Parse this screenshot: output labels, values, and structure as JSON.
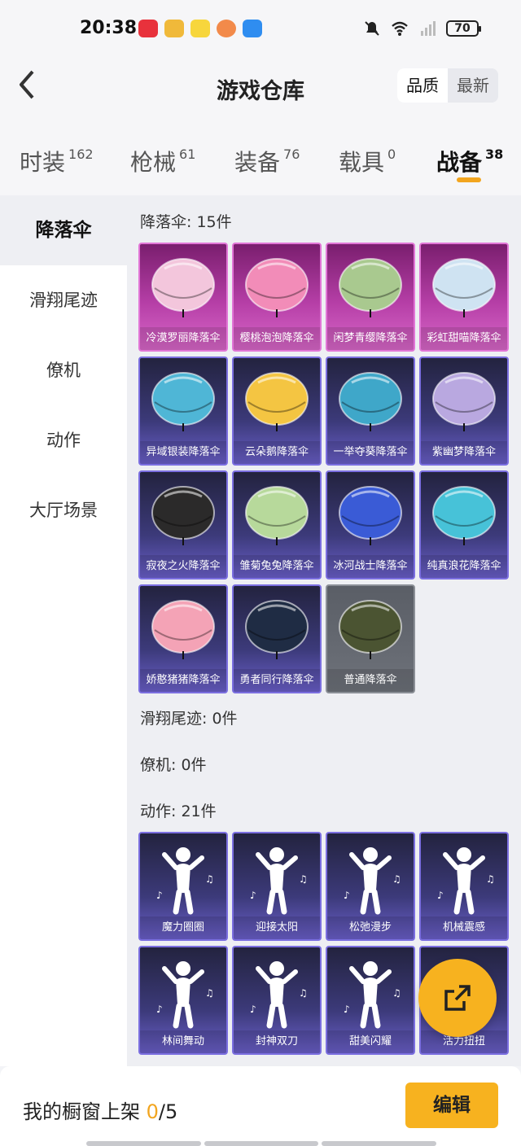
{
  "status_bar": {
    "time": "20:38",
    "battery": "70",
    "icons": [
      "notification-muted-icon",
      "wifi-icon",
      "signal-icon",
      "battery-icon"
    ]
  },
  "header": {
    "title": "游戏仓库",
    "sort_options": [
      "品质",
      "最新"
    ],
    "selected_sort": "品质"
  },
  "tabs": [
    {
      "label": "时装",
      "count": "162"
    },
    {
      "label": "枪械",
      "count": "61"
    },
    {
      "label": "装备",
      "count": "76"
    },
    {
      "label": "载具",
      "count": "0"
    },
    {
      "label": "战备",
      "count": "38"
    }
  ],
  "active_tab": "战备",
  "sidebar": {
    "items": [
      "降落伞",
      "滑翔尾迹",
      "僚机",
      "动作",
      "大厅场景"
    ],
    "active": "降落伞"
  },
  "sections": {
    "parachute": {
      "title": "降落伞: 15件",
      "items": [
        {
          "name": "冷漠罗丽降落伞",
          "rarity": "purple",
          "color": "#f3c6dc"
        },
        {
          "name": "樱桃泡泡降落伞",
          "rarity": "purple",
          "color": "#f28cb8"
        },
        {
          "name": "闲梦青缨降落伞",
          "rarity": "purple",
          "color": "#a9c98f"
        },
        {
          "name": "彩虹甜喵降落伞",
          "rarity": "purple",
          "color": "#cfe3f2"
        },
        {
          "name": "异域银装降落伞",
          "rarity": "blue",
          "color": "#4fb6d6"
        },
        {
          "name": "云朵鹅降落伞",
          "rarity": "blue",
          "color": "#f4c542"
        },
        {
          "name": "一举夺葵降落伞",
          "rarity": "blue",
          "color": "#3fa7c9"
        },
        {
          "name": "紫幽梦降落伞",
          "rarity": "blue",
          "color": "#b9a8e0"
        },
        {
          "name": "寂夜之火降落伞",
          "rarity": "blue",
          "color": "#2b2a2a"
        },
        {
          "name": "雏菊兔兔降落伞",
          "rarity": "blue",
          "color": "#b7d99b"
        },
        {
          "name": "冰河战士降落伞",
          "rarity": "blue",
          "color": "#3a5bd6"
        },
        {
          "name": "纯真浪花降落伞",
          "rarity": "blue",
          "color": "#47c2d8"
        },
        {
          "name": "娇憨猪猪降落伞",
          "rarity": "blue",
          "color": "#f4a3b6"
        },
        {
          "name": "勇者同行降落伞",
          "rarity": "blue",
          "color": "#1f2c44"
        },
        {
          "name": "普通降落伞",
          "rarity": "grey",
          "color": "#4b5432"
        }
      ]
    },
    "glide_trail": {
      "title": "滑翔尾迹: 0件"
    },
    "wingman": {
      "title": "僚机: 0件"
    },
    "emote": {
      "title": "动作: 21件",
      "items": [
        {
          "name": "魔力圈圈",
          "rarity": "blue"
        },
        {
          "name": "迎接太阳",
          "rarity": "blue"
        },
        {
          "name": "松弛漫步",
          "rarity": "blue"
        },
        {
          "name": "机械震感",
          "rarity": "blue"
        },
        {
          "name": "林间舞动",
          "rarity": "blue"
        },
        {
          "name": "封神双刀",
          "rarity": "blue"
        },
        {
          "name": "甜美闪耀",
          "rarity": "blue"
        },
        {
          "name": "活力扭扭",
          "rarity": "blue"
        }
      ]
    }
  },
  "bottom_bar": {
    "label": "我的橱窗上架 ",
    "current": "0",
    "total": "/5",
    "edit_label": "编辑"
  },
  "colors": {
    "accent": "#f7b21f",
    "purple_rarity": "#b53ea6",
    "blue_rarity": "#3c3a7a",
    "grey_rarity": "#6e727a"
  }
}
